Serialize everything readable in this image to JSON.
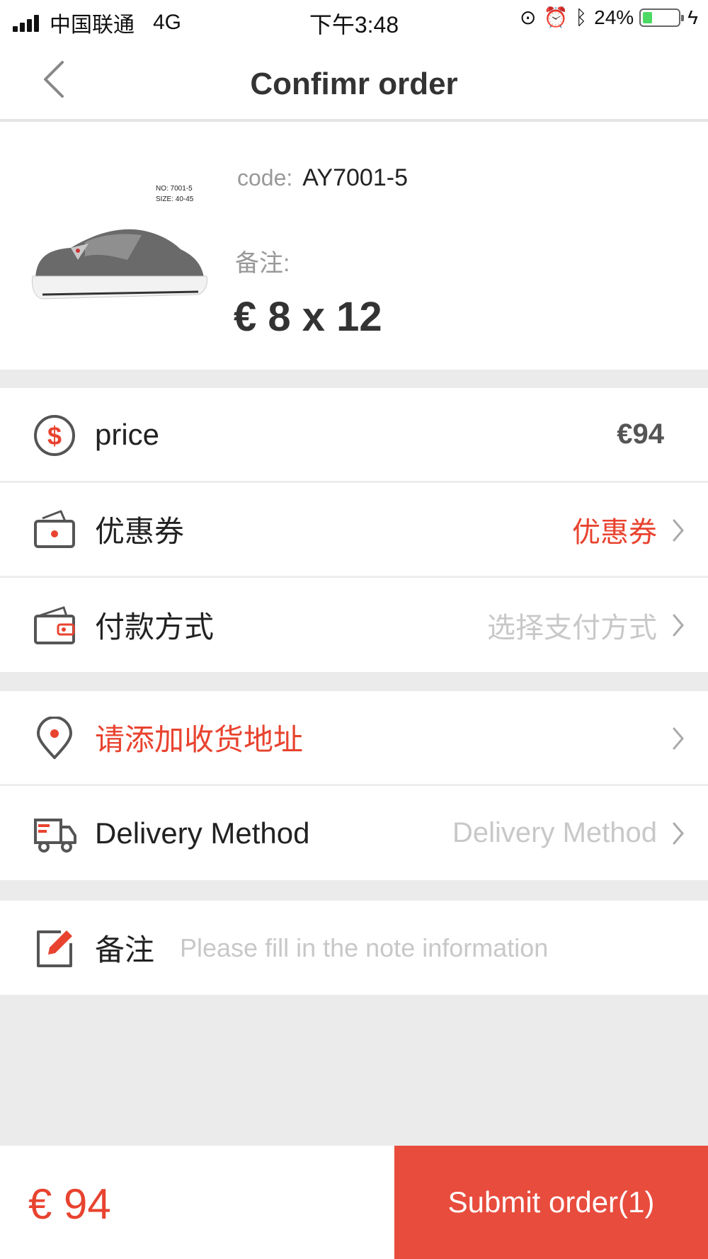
{
  "status_bar": {
    "carrier": "中国联通",
    "network": "4G",
    "time": "下午3:48",
    "battery": "24%",
    "battery_level": 0.24
  },
  "nav": {
    "title": "Confimr order"
  },
  "product": {
    "code_label": "code:",
    "code": "AY7001-5",
    "note_label": "备注:",
    "price_text": "€ 8 x 12",
    "image_text": [
      "NO: 7001-5",
      "SIZE: 40-45"
    ]
  },
  "rows": {
    "price": {
      "label": "price",
      "value": "€94"
    },
    "coupon": {
      "label": "优惠券",
      "value": "优惠券"
    },
    "payment": {
      "label": "付款方式",
      "value": "选择支付方式"
    },
    "address": {
      "label": "请添加收货地址"
    },
    "delivery": {
      "label": "Delivery Method",
      "value": "Delivery Method"
    },
    "note": {
      "label": "备注",
      "placeholder": "Please fill in the note information"
    }
  },
  "footer": {
    "total": "€ 94",
    "submit_label": "Submit order(1)"
  },
  "colors": {
    "accent_red": "#e84c3d",
    "muted_gray": "#999999",
    "placeholder_gray": "#c8c8c8"
  },
  "icons": [
    "back-chevron-icon",
    "dollar-icon",
    "coupon-icon",
    "wallet-icon",
    "location-pin-icon",
    "truck-icon",
    "edit-note-icon",
    "chevron-right-icon"
  ]
}
